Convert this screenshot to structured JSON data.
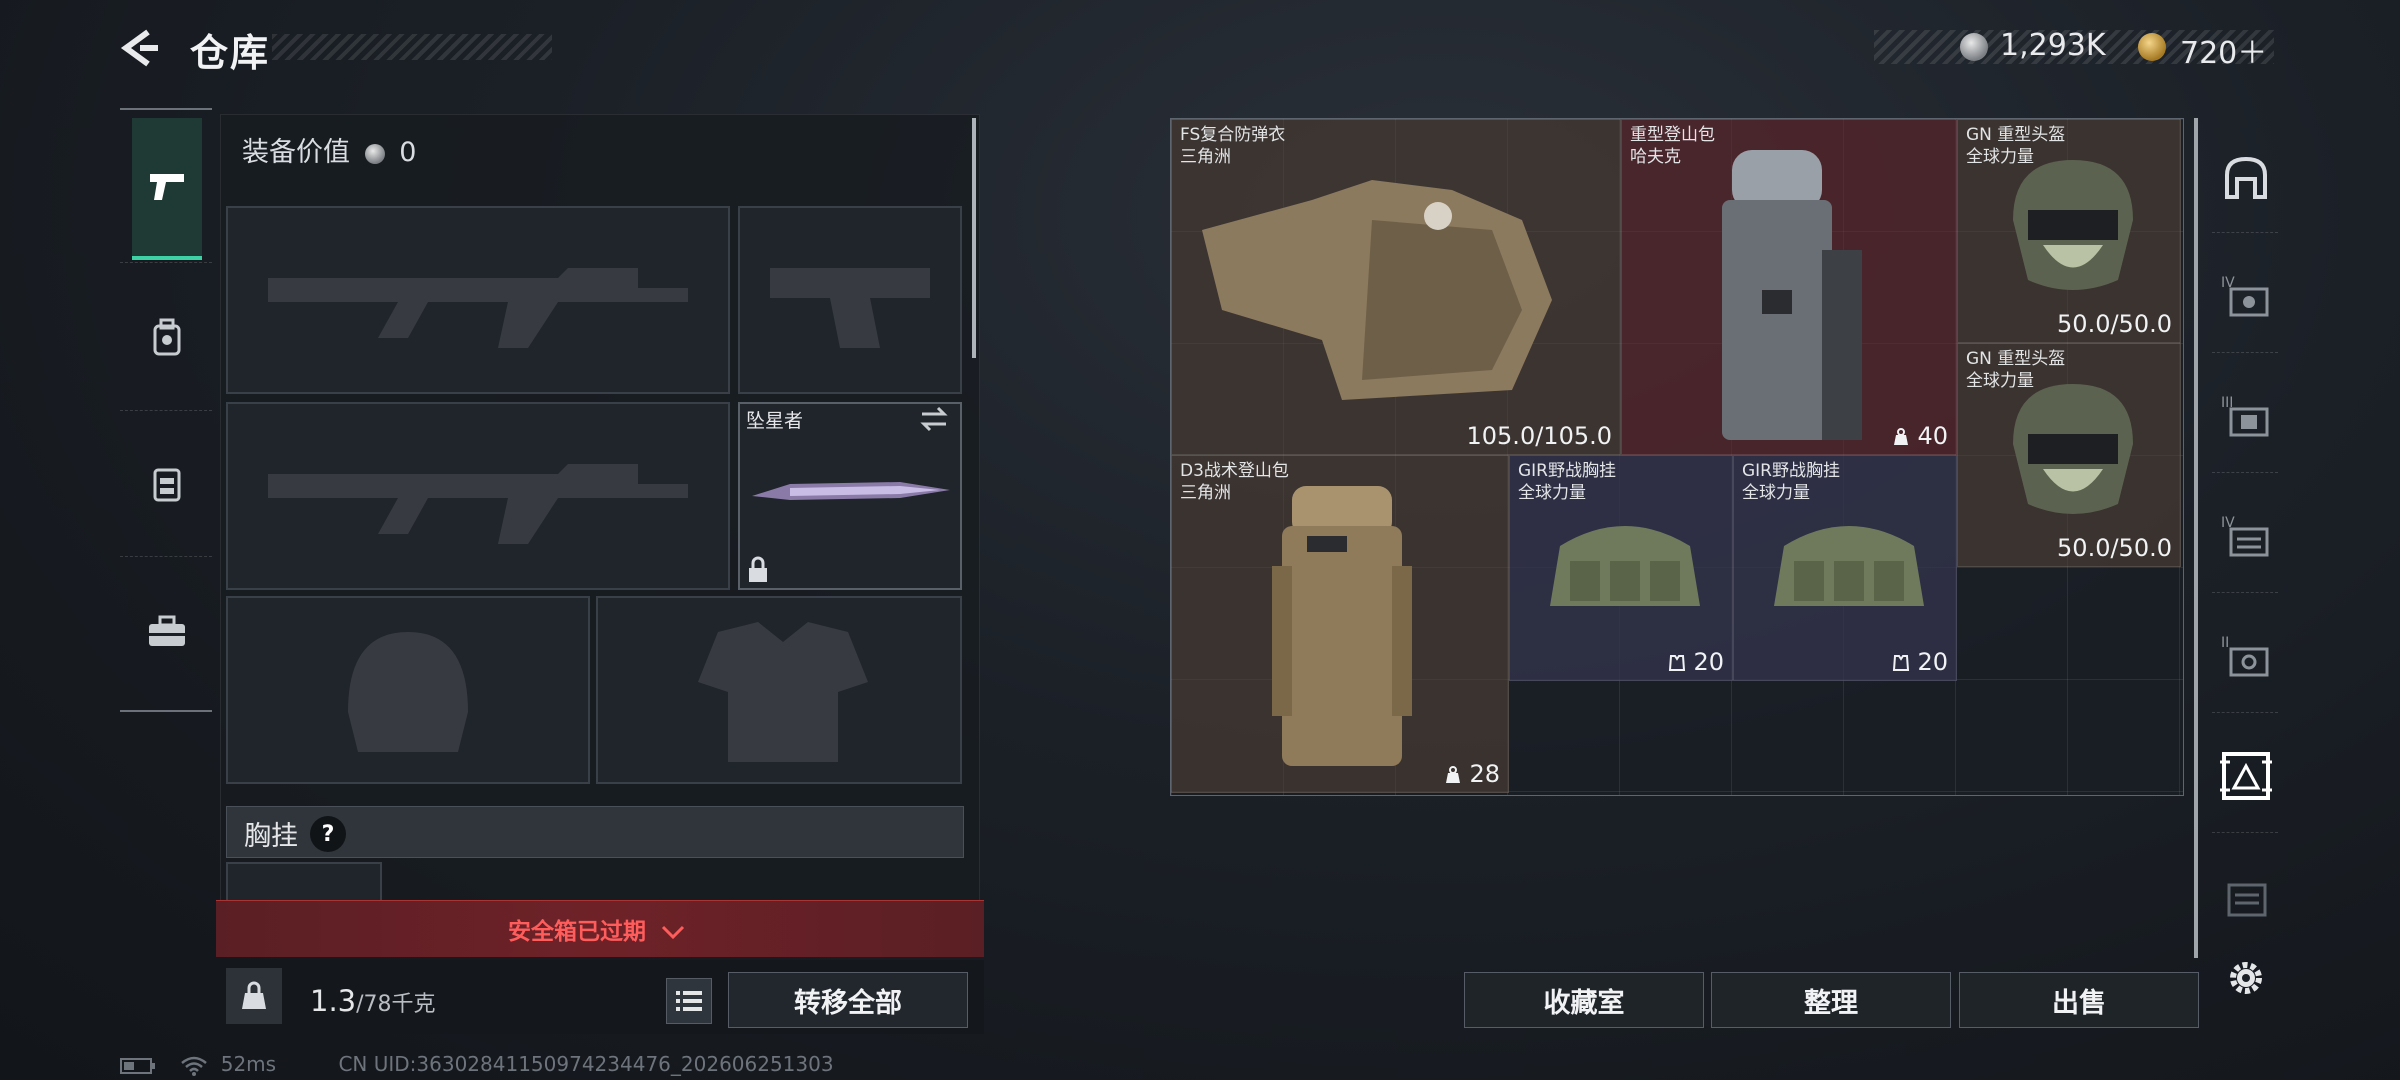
{
  "header": {
    "title": "仓库",
    "currency": [
      {
        "name": "silver-coin",
        "value": "1,293K"
      },
      {
        "name": "gold-coin",
        "value": "720＋"
      }
    ]
  },
  "categories": [
    {
      "icon": "pistol-icon",
      "active": true
    },
    {
      "icon": "backpack-icon",
      "active": false
    },
    {
      "icon": "vest-icon",
      "active": false
    },
    {
      "icon": "toolbox-icon",
      "active": false
    }
  ],
  "loadout": {
    "equip_value_label": "装备价值",
    "equip_value": "0",
    "melee_name": "坠星者",
    "vest_label": "胸挂",
    "vest_help": "?",
    "safe_box_text": "安全箱已过期",
    "weight_value": "1.3",
    "weight_unit": "/78千克",
    "transfer_all": "转移全部"
  },
  "stash_items": [
    {
      "name": "FS复合防弹衣",
      "sub": "三角洲",
      "value": "105.0/105.0"
    },
    {
      "name": "重型登山包",
      "sub": "哈夫克",
      "value": "40"
    },
    {
      "name": "GN 重型头盔",
      "sub": "全球力量",
      "value": "50.0/50.0"
    },
    {
      "name": "GN 重型头盔",
      "sub": "全球力量",
      "value": "50.0/50.0"
    },
    {
      "name": "D3战术登山包",
      "sub": "三角洲",
      "value": "28"
    },
    {
      "name": "GIR野战胸挂",
      "sub": "全球力量",
      "value": "20"
    },
    {
      "name": "GIR野战胸挂",
      "sub": "全球力量",
      "value": "20"
    }
  ],
  "bottom_buttons": {
    "collection": "收藏室",
    "organize": "整理",
    "sell": "出售"
  },
  "status": {
    "ping": "52ms",
    "uid": "CN UID:36302841150974234476_202606251303"
  }
}
